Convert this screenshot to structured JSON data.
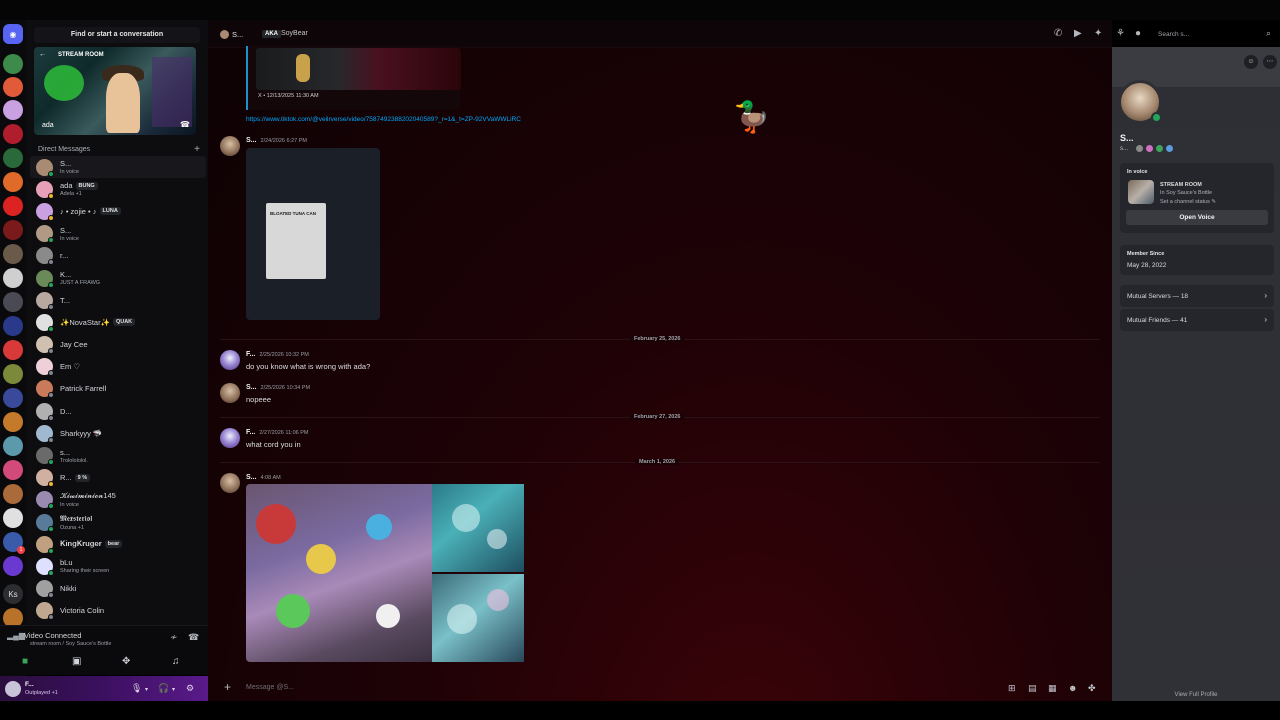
{
  "header": {
    "name": "S...",
    "aka_badge": "AKA",
    "alias": "SoyBear",
    "search_placeholder": "Search s..."
  },
  "sidebar": {
    "find_conversation": "Find or start a conversation",
    "stream_preview": {
      "label": "STREAM ROOM",
      "name": "ada"
    },
    "dm_header": "Direct Messages",
    "items": [
      {
        "name": "S...",
        "sub": "In voice",
        "tag": ""
      },
      {
        "name": "ada",
        "sub": "Adela +1",
        "tag": "BUNG"
      },
      {
        "name": "♪ • zojie • ♪",
        "sub": "",
        "tag": "LUNA"
      },
      {
        "name": "S...",
        "sub": "In voice",
        "tag": ""
      },
      {
        "name": "r...",
        "sub": "",
        "tag": ""
      },
      {
        "name": "K...",
        "sub": "JUST A FRAWG",
        "tag": ""
      },
      {
        "name": "T...",
        "sub": "",
        "tag": ""
      },
      {
        "name": "✨NovaStar✨",
        "sub": "",
        "tag": "QUAK"
      },
      {
        "name": "Jay Cee",
        "sub": "",
        "tag": ""
      },
      {
        "name": "Em ♡",
        "sub": "",
        "tag": ""
      },
      {
        "name": "Patrick Farrell",
        "sub": "",
        "tag": ""
      },
      {
        "name": "D...",
        "sub": "",
        "tag": ""
      },
      {
        "name": "Sharkyyy 🦈",
        "sub": "",
        "tag": ""
      },
      {
        "name": "s...",
        "sub": "Trololololol.",
        "tag": ""
      },
      {
        "name": "R...",
        "sub": "",
        "tag": "9 %"
      },
      {
        "name": "𝓚𝓲𝔀𝓲𝓶𝓲𝓷𝓲𝓸𝓷145",
        "sub": "In voice",
        "tag": ""
      },
      {
        "name": "𝕸𝖊𝖝𝖘𝖙𝖊𝖗𝖎𝖔𝖑",
        "sub": "Ozuna +1",
        "tag": ""
      },
      {
        "name": "𝐊𝐢𝐧𝐠𝐊𝐫𝐮𝐠𝐞𝐫",
        "sub": "",
        "tag": "bear"
      },
      {
        "name": "bLu",
        "sub": "Sharing their screen",
        "tag": ""
      },
      {
        "name": "Nikki",
        "sub": "",
        "tag": ""
      },
      {
        "name": "Victoria Colin",
        "sub": "",
        "tag": ""
      }
    ]
  },
  "voice": {
    "title": "Video Connected",
    "sub": "stream room / Soy Sauce's Bottle"
  },
  "user": {
    "name": "F...",
    "status": "Outplayed +1"
  },
  "chat": {
    "embed_source": "X • 12/13/2025 11:30 AM",
    "link": "https://www.tiktok.com/@veilrverse/video/7587492388202040589?_r=1&_t=ZP-92VVaWWLiRC",
    "dialog_title": "BLOATED TUNA CAN",
    "messages": [
      {
        "author": "S...",
        "time": "2/24/2026 6:27 PM",
        "text": ""
      },
      {
        "author": "F...",
        "time": "2/25/2026 10:32 PM",
        "text": "do you know what is wrong with ada?"
      },
      {
        "author": "S...",
        "time": "2/25/2026 10:34 PM",
        "text": "nopeee"
      },
      {
        "author": "F...",
        "time": "2/27/2026 11:06 PM",
        "text": "what cord you in"
      },
      {
        "author": "S...",
        "time": "4:08 AM",
        "text": ""
      }
    ],
    "dividers": [
      "February 25, 2026",
      "February 27, 2026",
      "March 1, 2026"
    ],
    "compose_placeholder": "Message @S..."
  },
  "profile": {
    "name": "S...",
    "sub": "s...",
    "in_voice_header": "In voice",
    "voice_channel": "STREAM ROOM",
    "voice_server": "In Soy Sauce's Bottle",
    "channel_status": "Set a channel status ✎",
    "open_voice": "Open Voice",
    "member_since_header": "Member Since",
    "member_since": "May 28, 2022",
    "mutual_servers": "Mutual Servers — 18",
    "mutual_friends": "Mutual Friends — 41",
    "view_full": "View Full Profile"
  },
  "colors": {
    "accent": "#5865f2",
    "online": "#23a55a",
    "link": "#00a8fc"
  }
}
